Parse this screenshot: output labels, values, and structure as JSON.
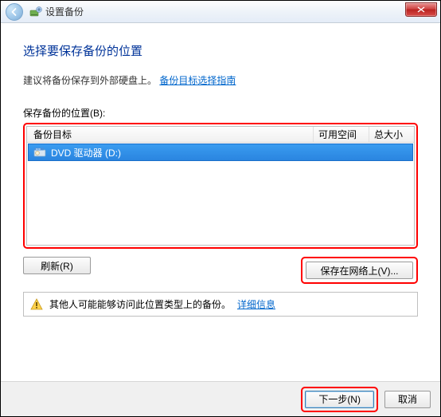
{
  "header": {
    "title": "设置备份"
  },
  "main": {
    "heading": "选择要保存备份的位置",
    "hint_text": "建议将备份保存到外部硬盘上。",
    "hint_link": "备份目标选择指南",
    "list_label": "保存备份的位置(B):"
  },
  "columns": {
    "target": "备份目标",
    "space": "可用空间",
    "size": "总大小"
  },
  "drives": [
    {
      "label": "DVD 驱动器 (D:)",
      "space": "",
      "size": ""
    }
  ],
  "buttons": {
    "refresh": "刷新(R)",
    "network": "保存在网络上(V)...",
    "next": "下一步(N)",
    "cancel": "取消"
  },
  "warning": {
    "text": "其他人可能能够访问此位置类型上的备份。",
    "link": "详细信息"
  }
}
